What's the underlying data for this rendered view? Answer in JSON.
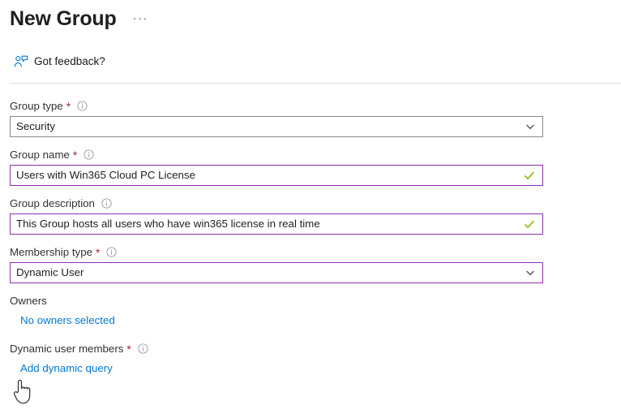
{
  "header": {
    "title": "New Group",
    "overflow_menu": "···",
    "overflow_menu_name": "more-options"
  },
  "feedback": {
    "label": "Got feedback?",
    "icon": "feedback-person-icon"
  },
  "colors": {
    "accent_border": "#8f2fae",
    "link": "#0078d4",
    "required_star": "#a4262c",
    "valid_check": "#7fba00",
    "default_border": "#8a8886",
    "divider": "#e1dfdd",
    "text": "#323130"
  },
  "form": {
    "fields": [
      {
        "label": "Group type",
        "required": true,
        "has_info": true,
        "value": "Security",
        "control": "dropdown",
        "state": "default",
        "valid": false,
        "name": "group-type"
      },
      {
        "label": "Group name",
        "required": true,
        "has_info": true,
        "value": "Users with Win365 Cloud PC License",
        "control": "textbox",
        "state": "accent",
        "valid": true,
        "name": "group-name"
      },
      {
        "label": "Group description",
        "required": false,
        "has_info": true,
        "value": "This Group hosts all users who have win365 license in real time",
        "control": "textbox",
        "state": "accent",
        "valid": true,
        "name": "group-description"
      },
      {
        "label": "Membership type",
        "required": true,
        "has_info": true,
        "value": "Dynamic User",
        "control": "dropdown",
        "state": "accent",
        "valid": false,
        "name": "membership-type"
      }
    ],
    "sections": [
      {
        "label": "Owners",
        "required": false,
        "has_info": false,
        "link": "No owners selected",
        "name": "owners"
      },
      {
        "label": "Dynamic user members",
        "required": true,
        "has_info": true,
        "link": "Add dynamic query",
        "name": "dynamic-user-members"
      }
    ]
  },
  "cursor": {
    "icon": "pointing-hand-cursor"
  }
}
